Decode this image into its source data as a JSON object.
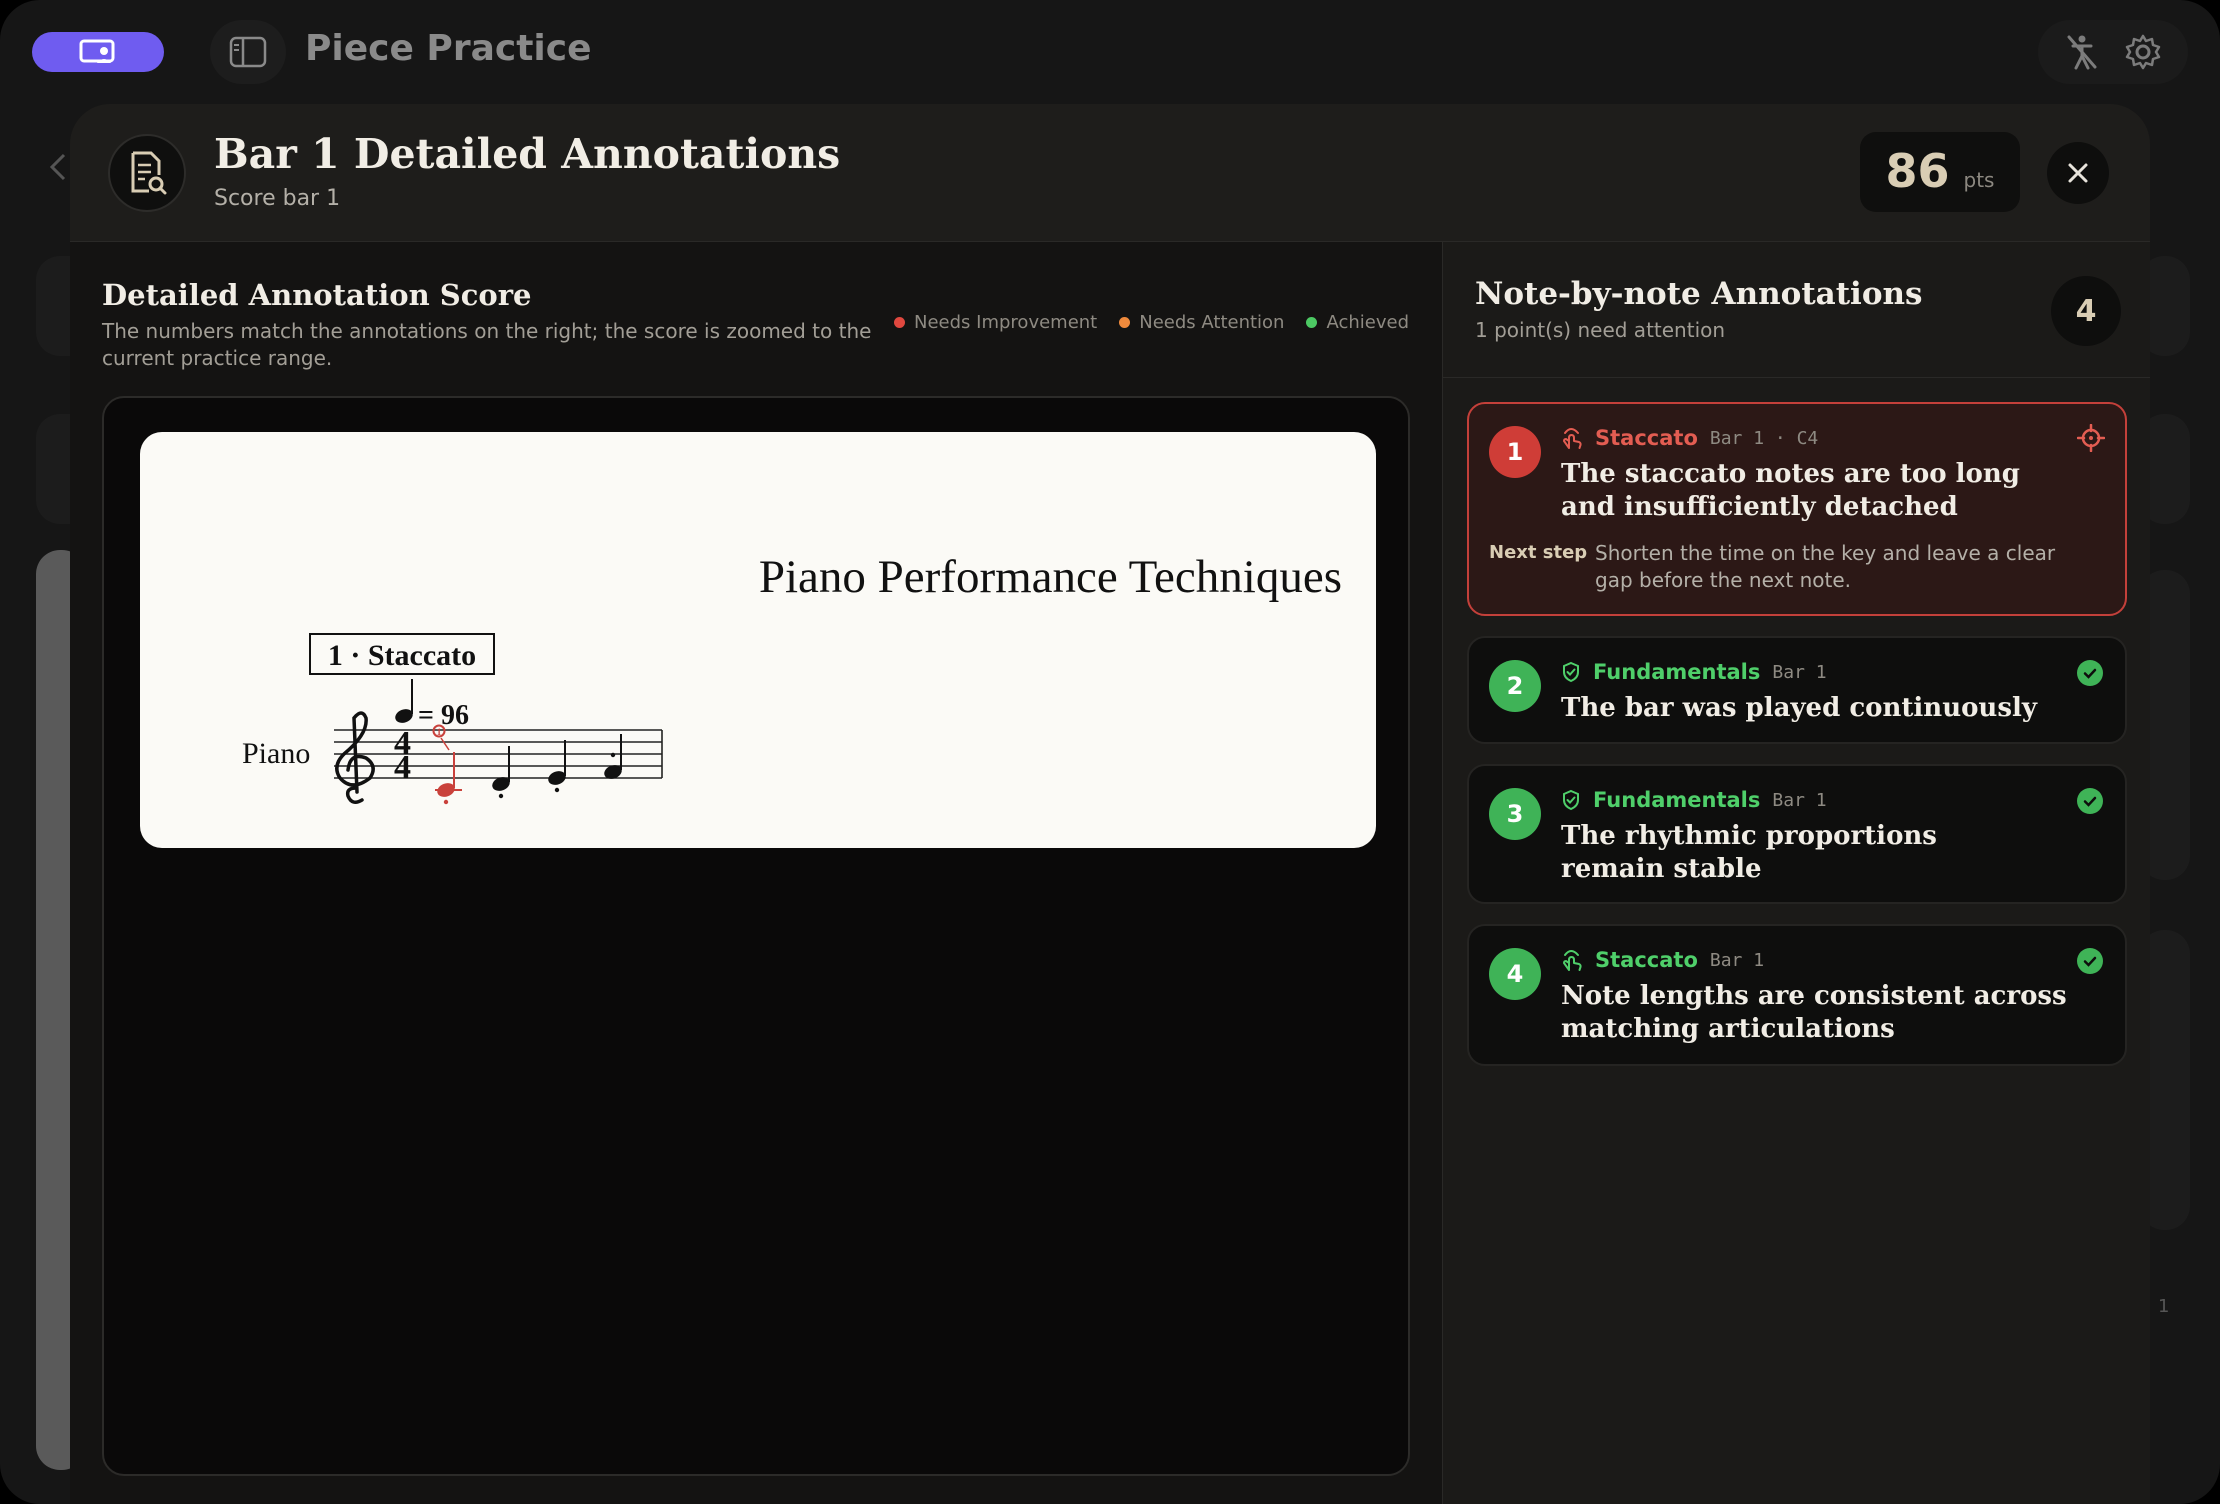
{
  "app": {
    "title": "Piece Practice"
  },
  "modal": {
    "title": "Bar 1 Detailed Annotations",
    "subtitle": "Score bar 1",
    "points": "86",
    "points_unit": "pts"
  },
  "score_panel": {
    "title": "Detailed Annotation Score",
    "description": "The numbers match the annotations on the right; the score is zoomed to the current practice range.",
    "legend": [
      {
        "label": "Needs Improvement",
        "color": "#e0483f"
      },
      {
        "label": "Needs Attention",
        "color": "#f08a3c"
      },
      {
        "label": "Achieved",
        "color": "#4cc963"
      }
    ],
    "score": {
      "piece_title": "Piano Performance Techniques",
      "rehearsal_mark": "1 · Staccato",
      "tempo": "= 96",
      "instrument": "Piano",
      "time_signature_top": "4",
      "time_signature_bottom": "4",
      "marker_number": "1"
    }
  },
  "annotations_panel": {
    "title": "Note-by-note Annotations",
    "subtitle": "1 point(s) need attention",
    "count": "4",
    "items": [
      {
        "number": "1",
        "status": "needs-improvement",
        "category": "Staccato",
        "category_icon": "hand-tap-icon",
        "location": "Bar 1 · C4",
        "title": "The staccato notes are too long and insufficiently detached",
        "next_step_label": "Next step",
        "next_step": "Shorten the time on the key and leave a clear gap before the next note."
      },
      {
        "number": "2",
        "status": "achieved",
        "category": "Fundamentals",
        "category_icon": "shield-check-icon",
        "location": "Bar 1",
        "title": "The bar was played continuously"
      },
      {
        "number": "3",
        "status": "achieved",
        "category": "Fundamentals",
        "category_icon": "shield-check-icon",
        "location": "Bar 1",
        "title": "The rhythmic proportions remain stable"
      },
      {
        "number": "4",
        "status": "achieved",
        "category": "Staccato",
        "category_icon": "hand-tap-icon",
        "location": "Bar 1",
        "title": "Note lengths are consistent across matching articulations"
      }
    ]
  },
  "background": {
    "badge_number": "1"
  }
}
